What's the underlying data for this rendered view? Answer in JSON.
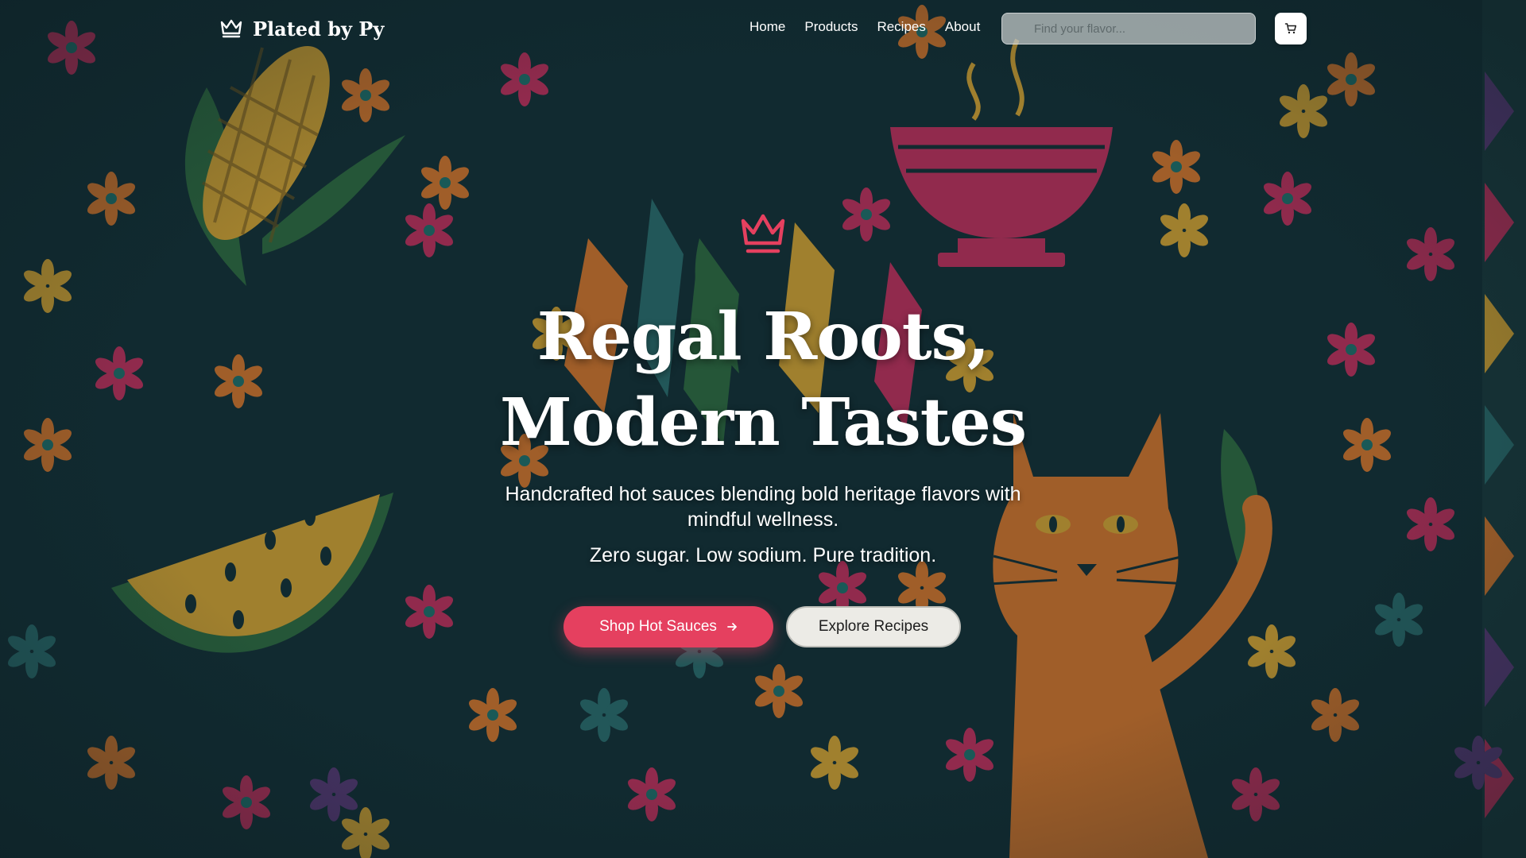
{
  "brand": {
    "name": "Plated by Py",
    "icon": "crown-icon"
  },
  "nav": {
    "links": [
      {
        "label": "Home"
      },
      {
        "label": "Products"
      },
      {
        "label": "Recipes"
      },
      {
        "label": "About"
      }
    ],
    "search_placeholder": "Find your flavor...",
    "cart_icon": "cart-icon"
  },
  "hero": {
    "icon": "crown-icon",
    "title_line1": "Regal Roots,",
    "title_line2": "Modern Tastes",
    "subtitle": "Handcrafted hot sauces blending bold heritage flavors with mindful wellness.",
    "tagline": "Zero sugar. Low sodium. Pure tradition.",
    "primary_cta": "Shop Hot Sauces",
    "secondary_cta": "Explore Recipes"
  },
  "colors": {
    "accent": "#e5405f",
    "background": "#132e34",
    "pattern_marigold": "#d9772a",
    "pattern_magenta": "#c42f5c",
    "pattern_gold": "#d9a531",
    "pattern_green": "#2e6b3f",
    "pattern_teal": "#2a6c6c",
    "pattern_purple": "#5e3a7a"
  }
}
